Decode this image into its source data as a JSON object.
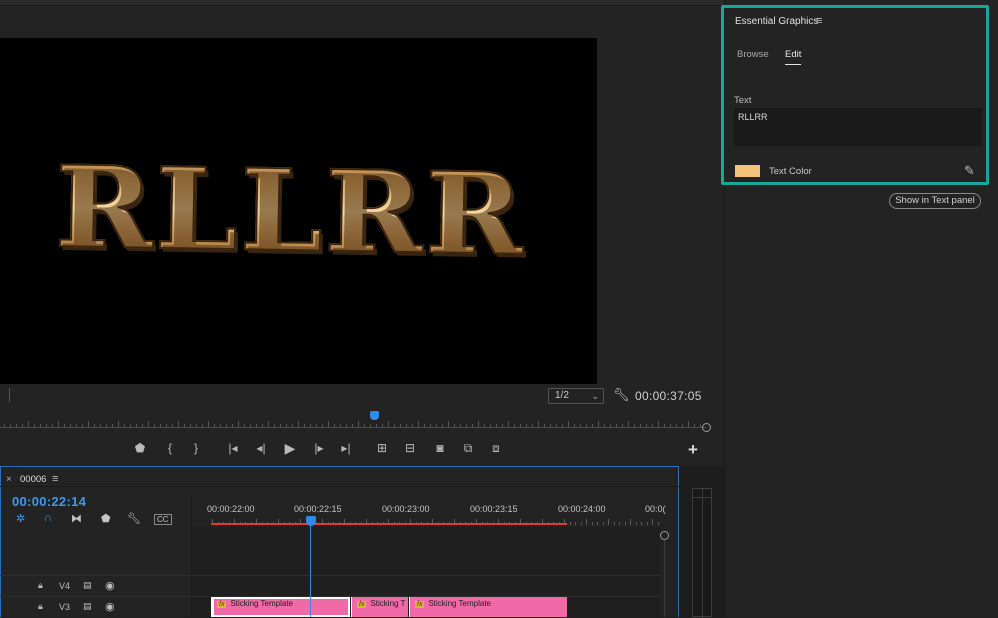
{
  "essential_graphics": {
    "title": "Essential Graphics",
    "menu_icon": "hamburger-icon",
    "tabs": [
      "Browse",
      "Edit"
    ],
    "active_tab": "Edit",
    "text_label": "Text",
    "text_value": "RLLRR",
    "text_color_label": "Text Color",
    "text_color": "#f5c27d",
    "highlight_color": "#14a89a",
    "show_in_text_panel": "Show in Text panel"
  },
  "program_monitor": {
    "preview_text": "RLLRR",
    "resolution": "1/2",
    "timecode": "00:00:37:05"
  },
  "timeline": {
    "sequence_name": "00006",
    "timecode": "00:00:22:14",
    "ruler_labels": [
      "00:00:22:00",
      "00:00:22:15",
      "00:00:23:00",
      "00:00:23:15",
      "00:00:24:00",
      "00:0("
    ],
    "tracks": [
      {
        "name": "V4"
      },
      {
        "name": "V3"
      }
    ],
    "clips": [
      {
        "label": "Sticking Template",
        "badge": "fx"
      },
      {
        "label": "Sticking T",
        "badge": "fx"
      },
      {
        "label": "Sticking Template",
        "badge": "fx"
      }
    ],
    "playhead_color": "#2d8ceb",
    "clip_color": "#f06aa8"
  }
}
